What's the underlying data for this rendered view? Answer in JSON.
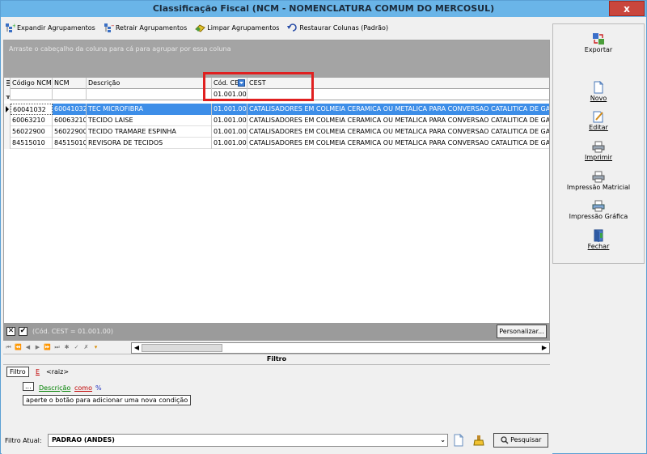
{
  "window": {
    "title": "Classificação Fiscal (NCM - NOMENCLATURA COMUM DO MERCOSUL)",
    "close_glyph": "x"
  },
  "toolbar": {
    "expand": "Expandir Agrupamentos",
    "collapse": "Retrair Agrupamentos",
    "clear": "Limpar Agrupamentos",
    "restore": "Restaurar Colunas (Padrão)"
  },
  "grid": {
    "group_hint": "Arraste o cabeçalho da coluna para cá para agrupar por essa coluna",
    "columns": [
      "Código NCM",
      "NCM",
      "Descrição",
      "Cód. CE",
      "CEST"
    ],
    "filter_values": {
      "cest_code": "01.001.00"
    },
    "rows": [
      {
        "codigo_ncm": "60041032",
        "ncm": "60041032",
        "descricao": "TEC MICROFIBRA",
        "cod_cest": "01.001.00",
        "cest": "CATALISADORES EM COLMEIA CERAMICA OU METALICA PARA CONVERSAO CATALITICA DE GASES"
      },
      {
        "codigo_ncm": "60063210",
        "ncm": "60063210",
        "descricao": "TECIDO LAISE",
        "cod_cest": "01.001.00",
        "cest": "CATALISADORES EM COLMEIA CERAMICA OU METALICA PARA CONVERSAO CATALITICA DE GASES"
      },
      {
        "codigo_ncm": "56022900",
        "ncm": "56022900",
        "descricao": "TECIDO TRAMARE ESPINHA",
        "cod_cest": "01.001.00",
        "cest": "CATALISADORES EM COLMEIA CERAMICA OU METALICA PARA CONVERSAO CATALITICA DE GASES"
      },
      {
        "codigo_ncm": "84515010",
        "ncm": "84515010",
        "descricao": "REVISORA DE TECIDOS",
        "cod_cest": "01.001.00",
        "cest": "CATALISADORES EM COLMEIA CERAMICA OU METALICA PARA CONVERSAO CATALITICA DE GASES"
      }
    ]
  },
  "filter_bar": {
    "x_glyph": "✕",
    "check_glyph": "✔",
    "expression": "(Cód. CEST = 01.001.00)",
    "customize": "Personalizar..."
  },
  "nav": {
    "buttons": [
      "⏮",
      "⏪",
      "◀",
      "▶",
      "⏩",
      "⏭",
      "✱",
      "✓",
      "✗",
      "▾"
    ],
    "left_arrow": "◀",
    "right_arrow": "▶"
  },
  "filter_panel": {
    "title": "Filtro",
    "root_label": "Filtro",
    "operator": "E",
    "root": "<raiz>",
    "ellipsis": "...",
    "field": "Descrição",
    "condition": "como",
    "value": "%",
    "tooltip": "aperte o botão para adicionar uma nova condição"
  },
  "bottom": {
    "label": "Filtro Atual:",
    "current": "PADRAO (ANDES)",
    "caret": "⌄",
    "search": "Pesquisar"
  },
  "actions": [
    {
      "label": "Exportar",
      "icon": "export-icon"
    },
    {
      "label": "Novo",
      "icon": "new-document-icon"
    },
    {
      "label": "Editar",
      "icon": "edit-icon"
    },
    {
      "label": "Imprimir",
      "icon": "printer-icon"
    },
    {
      "label": "Impressão Matricial",
      "icon": "printer-icon"
    },
    {
      "label": "Impressão Gráfica",
      "icon": "printer-icon"
    },
    {
      "label": "Fechar",
      "icon": "door-exit-icon"
    }
  ]
}
